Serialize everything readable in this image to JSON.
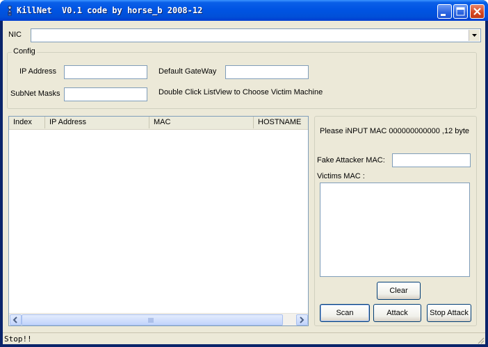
{
  "window": {
    "title": "KillNet  V0.1 code by horse_b 2008-12",
    "controls": [
      "minimize-icon",
      "maximize-icon",
      "close-icon"
    ]
  },
  "nic": {
    "label": "NIC",
    "value": ""
  },
  "config": {
    "group_title": "Config",
    "ip_label": "IP Address",
    "ip_value": "",
    "gateway_label": "Default GateWay",
    "gateway_value": "",
    "subnet_label": "SubNet Masks",
    "subnet_value": "",
    "hint": "Double Click ListView to Choose Victim Machine"
  },
  "listview": {
    "columns": [
      "Index",
      "IP Address",
      "MAC",
      "HOSTNAME"
    ],
    "rows": []
  },
  "attack_panel": {
    "info": "Please iNPUT MAC 000000000000 ,12 byte",
    "fake_mac_label": "Fake Attacker MAC:",
    "fake_mac_value": "",
    "victims_label": "Victims MAC :",
    "victims_value": "",
    "clear_label": "Clear",
    "scan_label": "Scan",
    "attack_label": "Attack",
    "stop_label": "Stop Attack"
  },
  "status": {
    "text": "Stop!!"
  },
  "colors": {
    "titlebar": "#0054e3",
    "face": "#ece9d8",
    "field_border": "#7f9db9"
  }
}
